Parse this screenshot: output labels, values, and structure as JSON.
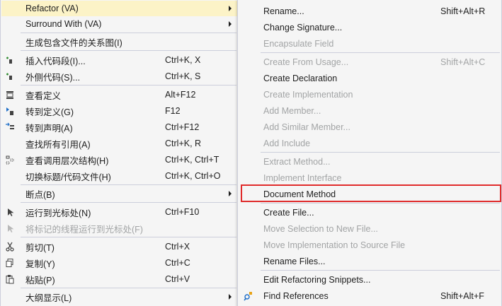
{
  "main_menu": {
    "refactor": {
      "label": "Refactor (VA)"
    },
    "surround": {
      "label": "Surround With (VA)"
    },
    "gen_relation": {
      "label": "生成包含文件的关系图(I)"
    },
    "insert_snippet": {
      "label": "插入代码段(I)...",
      "shortcut": "Ctrl+K, X"
    },
    "surround_code": {
      "label": "外侧代码(S)...",
      "shortcut": "Ctrl+K, S"
    },
    "peek_def": {
      "label": "查看定义",
      "shortcut": "Alt+F12"
    },
    "goto_def": {
      "label": "转到定义(G)",
      "shortcut": "F12"
    },
    "goto_decl": {
      "label": "转到声明(A)",
      "shortcut": "Ctrl+F12"
    },
    "find_refs": {
      "label": "查找所有引用(A)",
      "shortcut": "Ctrl+K, R"
    },
    "call_hierarchy": {
      "label": "查看调用层次结构(H)",
      "shortcut": "Ctrl+K, Ctrl+T"
    },
    "toggle_header": {
      "label": "切换标题/代码文件(H)",
      "shortcut": "Ctrl+K, Ctrl+O"
    },
    "breakpoint": {
      "label": "断点(B)"
    },
    "run_to_cursor": {
      "label": "运行到光标处(N)",
      "shortcut": "Ctrl+F10"
    },
    "run_marked": {
      "label": "将标记的线程运行到光标处(F)"
    },
    "cut": {
      "label": "剪切(T)",
      "shortcut": "Ctrl+X"
    },
    "copy": {
      "label": "复制(Y)",
      "shortcut": "Ctrl+C"
    },
    "paste": {
      "label": "粘贴(P)",
      "shortcut": "Ctrl+V"
    },
    "outline": {
      "label": "大纲显示(L)"
    }
  },
  "sub_menu": {
    "rename": {
      "label": "Rename...",
      "shortcut": "Shift+Alt+R"
    },
    "change_sig": {
      "label": "Change Signature..."
    },
    "encapsulate": {
      "label": "Encapsulate Field"
    },
    "create_from_usage": {
      "label": "Create From Usage...",
      "shortcut": "Shift+Alt+C"
    },
    "create_decl": {
      "label": "Create Declaration"
    },
    "create_impl": {
      "label": "Create Implementation"
    },
    "add_member": {
      "label": "Add Member..."
    },
    "add_similar": {
      "label": "Add Similar Member..."
    },
    "add_include": {
      "label": "Add Include"
    },
    "extract_method": {
      "label": "Extract Method..."
    },
    "implement_iface": {
      "label": "Implement Interface"
    },
    "document_method": {
      "label": "Document Method"
    },
    "create_file": {
      "label": "Create File..."
    },
    "move_selection": {
      "label": "Move Selection to New File..."
    },
    "move_impl": {
      "label": "Move Implementation to Source File"
    },
    "rename_files": {
      "label": "Rename Files..."
    },
    "edit_snippets": {
      "label": "Edit Refactoring Snippets..."
    },
    "find_references": {
      "label": "Find References",
      "shortcut": "Shift+Alt+F"
    }
  },
  "colors": {
    "highlight": "#fcf3c7",
    "disabled_text": "#a2a4a5",
    "focus_outline": "#e02b2b",
    "icon_blue": "#1e6ec8",
    "icon_green": "#2e8b2e"
  }
}
